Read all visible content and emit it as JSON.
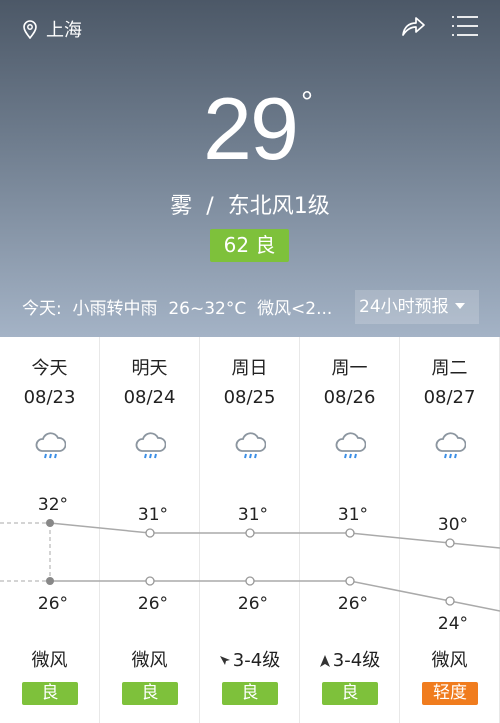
{
  "header": {
    "city": "上海",
    "location_icon": "pin-icon",
    "share_icon": "share-icon",
    "menu_icon": "menu-icon"
  },
  "current": {
    "temp": "29",
    "unit": "°",
    "weather": "雾",
    "separator": "/",
    "wind": "东北风1级",
    "aqi": "62 良",
    "aqi_color": "#7ec13b"
  },
  "today": {
    "label": "今天:",
    "weather": "小雨转中雨",
    "range": "26~32°C",
    "wind": "微风<2..."
  },
  "dropdown": {
    "label": "24小时预报"
  },
  "days": [
    {
      "day": "今天",
      "date": "08/23",
      "high": 32,
      "low": 26,
      "high_label": "32°",
      "low_label": "26°",
      "wind": "微风",
      "wind_icon": "",
      "aqi": "良",
      "aqi_color": "#7ec13b"
    },
    {
      "day": "明天",
      "date": "08/24",
      "high": 31,
      "low": 26,
      "high_label": "31°",
      "low_label": "26°",
      "wind": "微风",
      "wind_icon": "",
      "aqi": "良",
      "aqi_color": "#7ec13b"
    },
    {
      "day": "周日",
      "date": "08/25",
      "high": 31,
      "low": 26,
      "high_label": "31°",
      "low_label": "26°",
      "wind": "3-4级",
      "wind_icon": "arrow-northwest-icon",
      "aqi": "良",
      "aqi_color": "#7ec13b"
    },
    {
      "day": "周一",
      "date": "08/26",
      "high": 31,
      "low": 26,
      "high_label": "31°",
      "low_label": "26°",
      "wind": "3-4级",
      "wind_icon": "arrow-north-icon",
      "aqi": "良",
      "aqi_color": "#7ec13b"
    },
    {
      "day": "周二",
      "date": "08/27",
      "high": 30,
      "low": 24,
      "high_label": "30°",
      "low_label": "24°",
      "wind": "微风",
      "wind_icon": "",
      "aqi": "轻度",
      "aqi_color": "#f07c1e"
    }
  ],
  "weather_icon": "rain-cloud-icon"
}
